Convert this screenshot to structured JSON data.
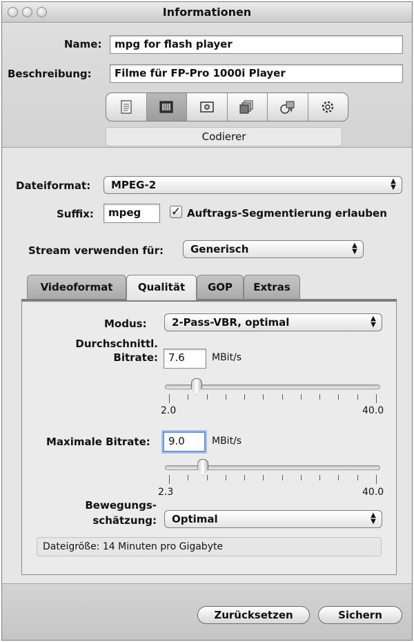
{
  "window": {
    "title": "Informationen"
  },
  "header": {
    "name_label": "Name:",
    "name_value": "mpg for flash player",
    "desc_label": "Beschreibung:",
    "desc_value": "Filme für FP-Pro 1000i Player",
    "toolbar_icons": [
      "summary-icon",
      "encoder-icon",
      "filters-icon",
      "frame-controls-icon",
      "geometry-icon",
      "actions-icon"
    ],
    "selected_pane_label": "Codierer"
  },
  "format": {
    "dateiformat_label": "Dateiformat:",
    "dateiformat_value": "MPEG-2",
    "suffix_label": "Suffix:",
    "suffix_value": "mpeg",
    "segment_checkbox_label": "Auftrags-Segmentierung erlauben",
    "segment_checked": true,
    "stream_label": "Stream verwenden für:",
    "stream_value": "Generisch"
  },
  "tabs": [
    {
      "label": "Videoformat",
      "active": false
    },
    {
      "label": "Qualität",
      "active": true
    },
    {
      "label": "GOP",
      "active": false
    },
    {
      "label": "Extras",
      "active": false
    }
  ],
  "quality": {
    "modus_label": "Modus:",
    "modus_value": "2-Pass-VBR, optimal",
    "avg_label_line1": "Durchschnittl.",
    "avg_label_line2": "Bitrate:",
    "avg_value": "7.6",
    "avg_unit": "MBit/s",
    "avg_slider": {
      "min_label": "2.0",
      "max_label": "40.0",
      "value": 7.6,
      "min": 2.0,
      "max": 40.0
    },
    "max_label": "Maximale Bitrate:",
    "max_value": "9.0",
    "max_unit": "MBit/s",
    "max_slider": {
      "min_label": "2.3",
      "max_label": "40.0",
      "value": 9.0,
      "min": 2.3,
      "max": 40.0
    },
    "motion_label_line1": "Bewegungs-",
    "motion_label_line2": "schätzung:",
    "motion_value": "Optimal",
    "filesize_text": "Dateigröße: 14 Minuten pro Gigabyte"
  },
  "footer": {
    "reset_label": "Zurücksetzen",
    "save_label": "Sichern"
  }
}
